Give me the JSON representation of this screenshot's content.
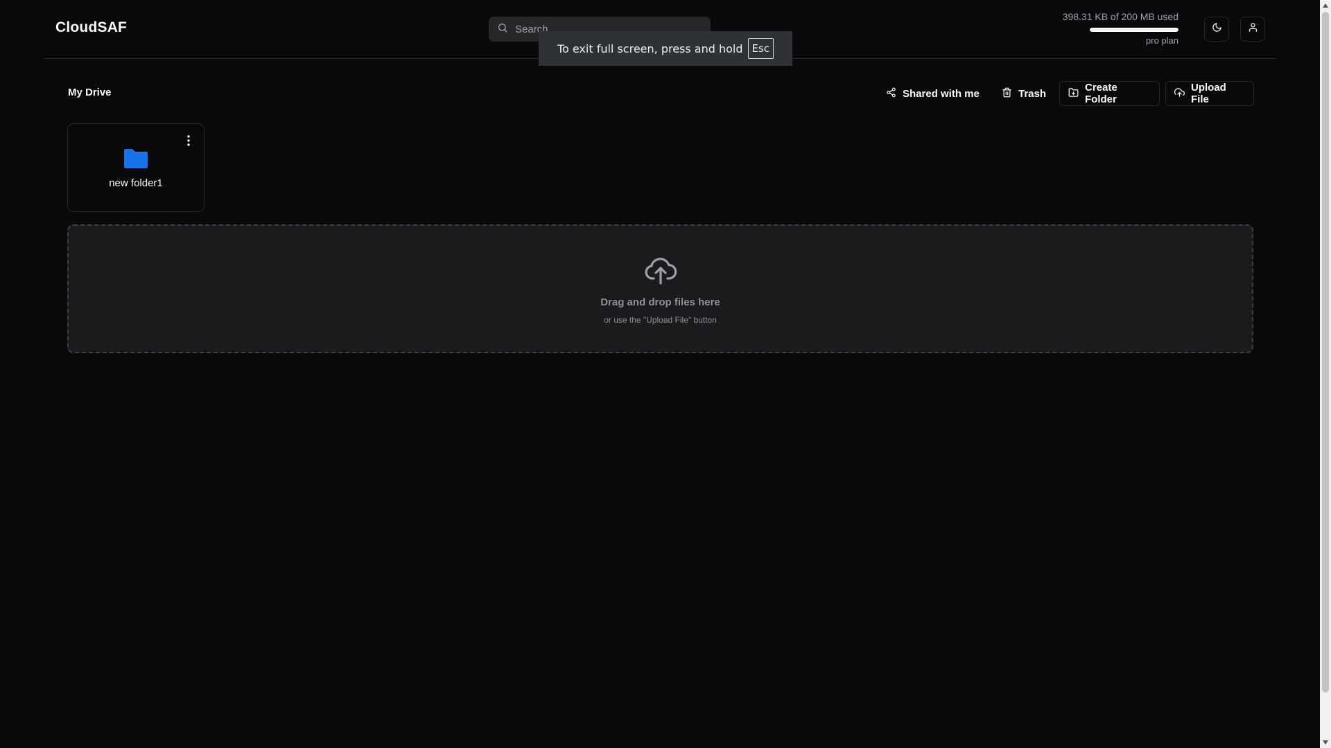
{
  "app": {
    "title": "CloudSAF"
  },
  "search": {
    "placeholder": "Search",
    "icon": "search-icon"
  },
  "storage": {
    "usage_text": "398.31 KB of 200 MB used",
    "used_fraction": 0.998,
    "plan": "pro plan"
  },
  "header_buttons": {
    "theme_icon": "moon-icon",
    "user_icon": "user-icon"
  },
  "fullscreen_toast": {
    "message": "To exit full screen, press and hold",
    "key": "Esc"
  },
  "page": {
    "title": "My Drive"
  },
  "toolbar": {
    "shared_label": "Shared with me",
    "trash_label": "Trash",
    "create_folder_label": "Create Folder",
    "upload_file_label": "Upload File"
  },
  "folders": [
    {
      "name": "new folder1",
      "icon": "folder-icon",
      "color": "#1a73e8"
    }
  ],
  "dropzone": {
    "title": "Drag and drop files here",
    "subtitle": "or use the \"Upload File\" button",
    "icon": "cloud-upload-icon"
  },
  "colors": {
    "background": "#09090b",
    "border": "#27272a",
    "folder": "#1a73e8",
    "dropzone_bg": "#1b1b1e"
  }
}
